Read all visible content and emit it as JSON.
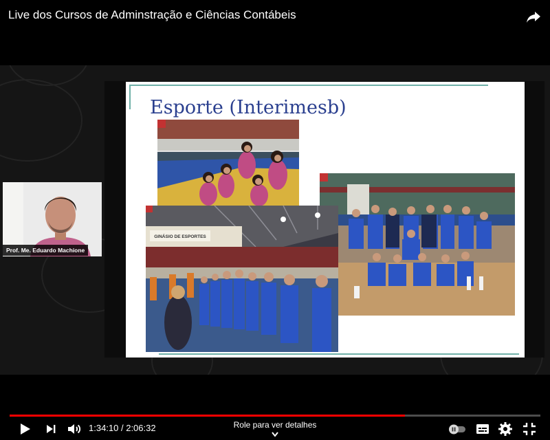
{
  "video": {
    "title": "Live dos Cursos de Adminstração e Ciências Contábeis"
  },
  "slide": {
    "title": "Esporte (Interimesb)",
    "gym_sign": "GINÁSIO DE ESPORTES"
  },
  "webcam": {
    "presenter_name": "Prof. Me. Eduardo Machione"
  },
  "player": {
    "current_time": "1:34:10",
    "duration": "2:06:32",
    "time_separator": " / ",
    "progress_fraction": 0.745,
    "details_hint": "Role para ver detalhes",
    "accent_color": "#ff0000",
    "icons": [
      "share-icon",
      "play-icon",
      "next-icon",
      "volume-icon",
      "autoplay-toggle-icon",
      "subtitles-icon",
      "settings-gear-icon",
      "exit-fullscreen-icon",
      "chevron-down-icon"
    ]
  }
}
